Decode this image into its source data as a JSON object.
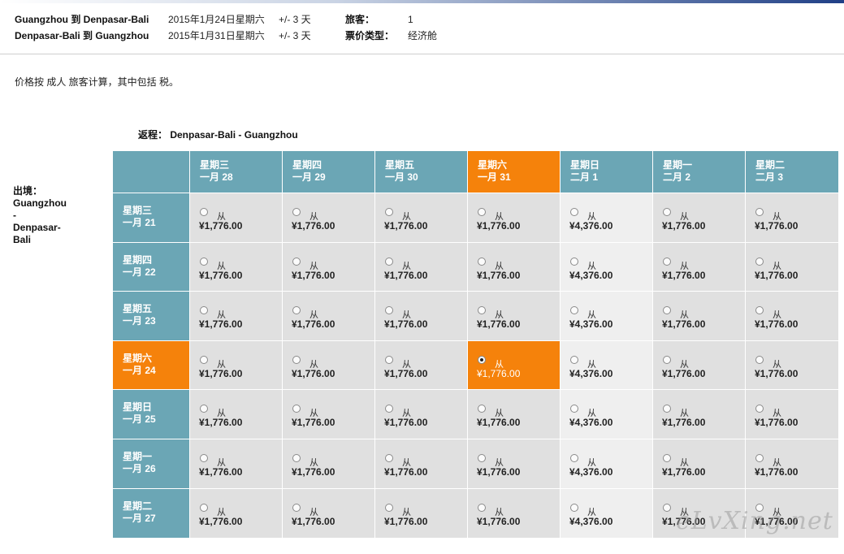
{
  "summary": {
    "leg1_route": "Guangzhou 到 Denpasar-Bali",
    "leg1_date": "2015年1月24日星期六",
    "leg1_flex": "+/- 3 天",
    "leg2_route": "Denpasar-Bali 到 Guangzhou",
    "leg2_date": "2015年1月31日星期六",
    "leg2_flex": "+/- 3 天",
    "passengers_label": "旅客：",
    "passengers_value": "1",
    "fare_type_label": "票价类型：",
    "fare_type_value": "经济舱"
  },
  "note": "价格按 成人 旅客计算，其中包括 税。",
  "return_label": "返程： Denpasar-Bali - Guangzhou",
  "outbound_label": {
    "line1": "出境：",
    "line2": "Guangzhou",
    "line3": "-",
    "line4": "Denpasar-",
    "line5": "Bali"
  },
  "columns": [
    {
      "weekday": "星期三",
      "date": "一月 28"
    },
    {
      "weekday": "星期四",
      "date": "一月 29"
    },
    {
      "weekday": "星期五",
      "date": "一月 30"
    },
    {
      "weekday": "星期六",
      "date": "一月 31"
    },
    {
      "weekday": "星期日",
      "date": "二月 1"
    },
    {
      "weekday": "星期一",
      "date": "二月 2"
    },
    {
      "weekday": "星期二",
      "date": "二月 3"
    }
  ],
  "rows": [
    {
      "weekday": "星期三",
      "date": "一月 21"
    },
    {
      "weekday": "星期四",
      "date": "一月 22"
    },
    {
      "weekday": "星期五",
      "date": "一月 23"
    },
    {
      "weekday": "星期六",
      "date": "一月 24"
    },
    {
      "weekday": "星期日",
      "date": "一月 25"
    },
    {
      "weekday": "星期一",
      "date": "一月 26"
    },
    {
      "weekday": "星期二",
      "date": "一月 27"
    }
  ],
  "from_label": "从",
  "prices": [
    [
      "¥1,776.00",
      "¥1,776.00",
      "¥1,776.00",
      "¥1,776.00",
      "¥4,376.00",
      "¥1,776.00",
      "¥1,776.00"
    ],
    [
      "¥1,776.00",
      "¥1,776.00",
      "¥1,776.00",
      "¥1,776.00",
      "¥4,376.00",
      "¥1,776.00",
      "¥1,776.00"
    ],
    [
      "¥1,776.00",
      "¥1,776.00",
      "¥1,776.00",
      "¥1,776.00",
      "¥4,376.00",
      "¥1,776.00",
      "¥1,776.00"
    ],
    [
      "¥1,776.00",
      "¥1,776.00",
      "¥1,776.00",
      "¥1,776.00",
      "¥4,376.00",
      "¥1,776.00",
      "¥1,776.00"
    ],
    [
      "¥1,776.00",
      "¥1,776.00",
      "¥1,776.00",
      "¥1,776.00",
      "¥4,376.00",
      "¥1,776.00",
      "¥1,776.00"
    ],
    [
      "¥1,776.00",
      "¥1,776.00",
      "¥1,776.00",
      "¥1,776.00",
      "¥4,376.00",
      "¥1,776.00",
      "¥1,776.00"
    ],
    [
      "¥1,776.00",
      "¥1,776.00",
      "¥1,776.00",
      "¥1,776.00",
      "¥4,376.00",
      "¥1,776.00",
      "¥1,776.00"
    ]
  ],
  "selected": {
    "row": 3,
    "col": 3
  },
  "watermark": "eLvXing.net",
  "colors": {
    "header": "#6ba6b5",
    "selected": "#f5820b",
    "cell": "#e0e0e0",
    "cell_high": "#efefef"
  }
}
